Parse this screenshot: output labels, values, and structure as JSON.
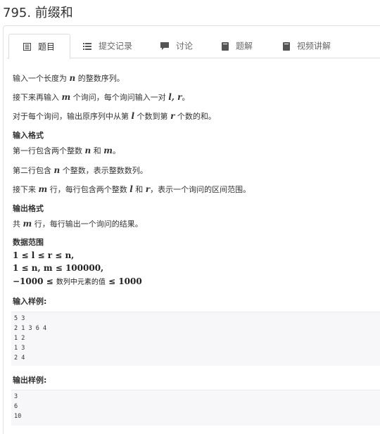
{
  "problem": {
    "title": "795. 前缀和"
  },
  "tabs": [
    {
      "label": "题目",
      "icon": "document-list-icon",
      "active": true
    },
    {
      "label": "提交记录",
      "icon": "list-icon"
    },
    {
      "label": "讨论",
      "icon": "comment-icon"
    },
    {
      "label": "题解",
      "icon": "book-icon"
    },
    {
      "label": "视频讲解",
      "icon": "video-book-icon"
    }
  ],
  "description": {
    "line1_pre": "输入一个长度为 ",
    "line1_var": "n",
    "line1_post": " 的整数序列。",
    "line2_pre": "接下来再输入 ",
    "line2_var": "m",
    "line2_mid": " 个询问，每个询问输入一对 ",
    "line2_vars": "l, r",
    "line2_post": "。",
    "line3_pre": "对于每个询问，输出原序列中从第 ",
    "line3_var1": "l",
    "line3_mid": " 个数到第 ",
    "line3_var2": "r",
    "line3_post": " 个数的和。"
  },
  "input_format": {
    "heading": "输入格式",
    "l1_pre": "第一行包含两个整数 ",
    "l1_v1": "n",
    "l1_mid": " 和 ",
    "l1_v2": "m",
    "l1_post": "。",
    "l2_pre": "第二行包含 ",
    "l2_v": "n",
    "l2_post": " 个整数，表示整数数列。",
    "l3_pre": "接下来 ",
    "l3_v1": "m",
    "l3_mid1": " 行，每行包含两个整数 ",
    "l3_v2": "l",
    "l3_mid2": " 和 ",
    "l3_v3": "r",
    "l3_post": "，表示一个询问的区间范围。"
  },
  "output_format": {
    "heading": "输出格式",
    "l1_pre": "共 ",
    "l1_v": "m",
    "l1_post": " 行，每行输出一个询问的结果。"
  },
  "range": {
    "heading": "数据范围",
    "r1": "1 ≤ l ≤ r ≤ n,",
    "r2": "1 ≤ n, m ≤ 100000,",
    "r3_pre": "−1000 ≤ ",
    "r3_text": "数列中元素的值",
    "r3_post": " ≤ 1000"
  },
  "sample_input": {
    "heading": "输入样例:",
    "lines": [
      "5 3",
      "2 1 3 6 4",
      "1 2",
      "1 3",
      "2 4"
    ]
  },
  "sample_output": {
    "heading": "输出样例:",
    "lines": [
      "3",
      "6",
      "10"
    ]
  }
}
